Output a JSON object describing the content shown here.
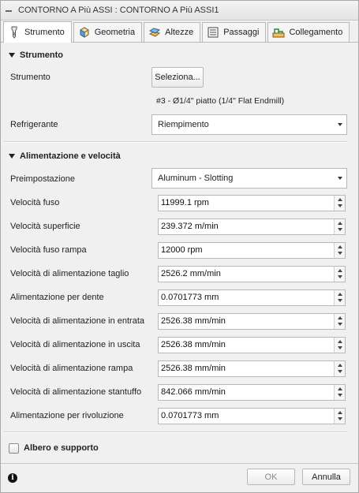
{
  "window": {
    "title": "CONTORNO A Più ASSI : CONTORNO A Più ASSI1"
  },
  "tabs": [
    {
      "label": "Strumento",
      "icon": "tool-tab-icon",
      "active": true
    },
    {
      "label": "Geometria",
      "icon": "geometry-cube-icon"
    },
    {
      "label": "Altezze",
      "icon": "heights-icon"
    },
    {
      "label": "Passaggi",
      "icon": "passes-icon"
    },
    {
      "label": "Collegamento",
      "icon": "linking-icon"
    }
  ],
  "tool_section": {
    "title": "Strumento",
    "strumento_label": "Strumento",
    "select_button": "Seleziona...",
    "tool_description": "#3 - Ø1/4\" piatto (1/4\" Flat Endmill)",
    "coolant_label": "Refrigerante",
    "coolant_value": "Riempimento"
  },
  "feed_section": {
    "title": "Alimentazione e velocità",
    "preset_label": "Preimpostazione",
    "preset_value": "Aluminum - Slotting",
    "fields": [
      {
        "label": "Velocità fuso",
        "value": "11999.1 rpm"
      },
      {
        "label": "Velocità superficie",
        "value": "239.372 m/min"
      },
      {
        "label": "Velocità fuso rampa",
        "value": "12000 rpm"
      },
      {
        "label": "Velocità di alimentazione taglio",
        "value": "2526.2 mm/min"
      },
      {
        "label": "Alimentazione per dente",
        "value": "0.0701773 mm"
      },
      {
        "label": "Velocità di alimentazione in entrata",
        "value": "2526.38 mm/min"
      },
      {
        "label": "Velocità di alimentazione in uscita",
        "value": "2526.38 mm/min"
      },
      {
        "label": "Velocità di alimentazione rampa",
        "value": "2526.38 mm/min"
      },
      {
        "label": "Velocità di alimentazione stantuffo",
        "value": "842.066 mm/min"
      },
      {
        "label": "Alimentazione per rivoluzione",
        "value": "0.0701773 mm"
      }
    ]
  },
  "holder_section": {
    "title": "Albero e supporto",
    "checked": false
  },
  "footer": {
    "ok_label": "OK",
    "cancel_label": "Annulla",
    "info_glyph": "i"
  }
}
